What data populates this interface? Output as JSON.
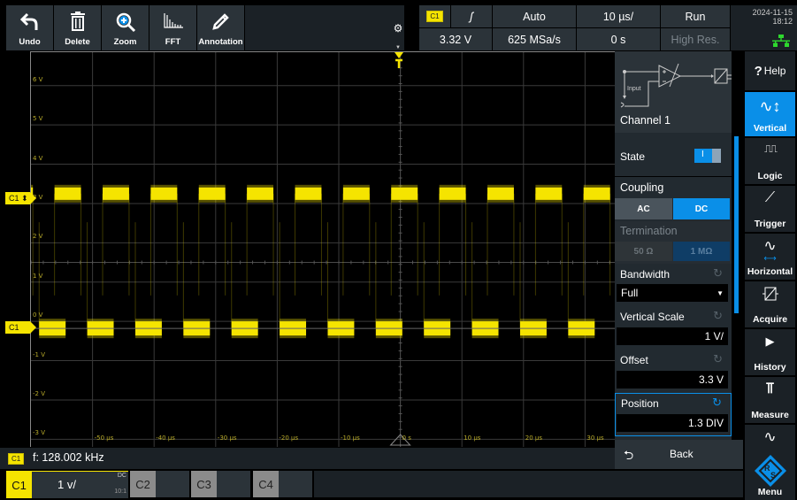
{
  "toolbar": {
    "buttons": [
      {
        "label": "Undo",
        "icon": "undo-icon"
      },
      {
        "label": "Delete",
        "icon": "trash-icon"
      },
      {
        "label": "Zoom",
        "icon": "zoom-icon"
      },
      {
        "label": "FFT",
        "icon": "fft-icon"
      },
      {
        "label": "Annotation",
        "icon": "pencil-icon"
      }
    ]
  },
  "status": {
    "trigger_source": "C1",
    "trigger_slope": "ʃ",
    "trigger_mode": "Auto",
    "time_scale": "10 µs/",
    "run_state": "Run",
    "trigger_level": "3.32 V",
    "sample_rate": "625 MSa/s",
    "trigger_position": "0 s",
    "acquisition_mode": "High Res.",
    "date": "2024-11-15",
    "time": "18:12"
  },
  "scope": {
    "y_labels": [
      "6 V",
      "5 V",
      "4 V",
      "3 V",
      "2 V",
      "1 V",
      "0 V",
      "-1 V",
      "-2 V",
      "-3 V"
    ],
    "x_labels": [
      "-50 µs",
      "-40 µs",
      "-30 µs",
      "-20 µs",
      "-10 µs",
      "0 s",
      "10 µs",
      "20 µs",
      "30 µs"
    ],
    "trigger_marker": "T",
    "channel_markers": [
      {
        "label": "C1 ⬍",
        "color": "#f5e400"
      },
      {
        "label": "C1",
        "color": "#f5e400"
      }
    ],
    "trace_color": "#f5e400",
    "signal_frequency_khz": 128.002
  },
  "panel": {
    "diagram_input_label": "Input",
    "title": "Channel 1",
    "state_label": "State",
    "state_toggle": "I",
    "state_on": true,
    "coupling_label": "Coupling",
    "coupling_options": [
      "AC",
      "DC"
    ],
    "coupling_selected": "DC",
    "termination_label": "Termination",
    "termination_options": [
      "50 Ω",
      "1 MΩ"
    ],
    "termination_selected": "1 MΩ",
    "bandwidth_label": "Bandwidth",
    "bandwidth_value": "Full",
    "vertical_scale_label": "Vertical Scale",
    "vertical_scale_value": "1 V/",
    "offset_label": "Offset",
    "offset_value": "3.3 V",
    "position_label": "Position",
    "position_value": "1.3 DIV",
    "back_label": "Back"
  },
  "nav": {
    "help": "Help",
    "items": [
      "Vertical",
      "Logic",
      "Trigger",
      "Horizontal",
      "Acquire",
      "History",
      "Measure"
    ],
    "active": "Vertical",
    "menu": "Menu",
    "accent": "#0a8fe8"
  },
  "bottom": {
    "freq_badge": "C1",
    "freq_text": "f: 128.002 kHz",
    "channels": [
      {
        "name": "C1",
        "scale": "1 v/",
        "coupling": "DC",
        "probe": "10:1",
        "active": true
      },
      {
        "name": "C2",
        "active": false
      },
      {
        "name": "C3",
        "active": false
      },
      {
        "name": "C4",
        "active": false
      }
    ]
  }
}
